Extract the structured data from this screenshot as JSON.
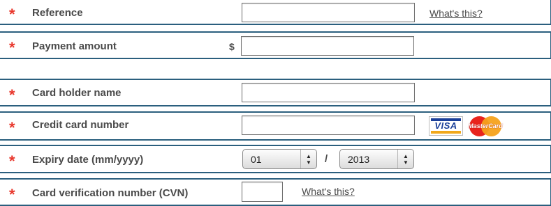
{
  "form": {
    "reference": {
      "label": "Reference",
      "required_mark": "*",
      "value": "",
      "help_link": "What's this?"
    },
    "payment_amount": {
      "label": "Payment amount",
      "required_mark": "*",
      "currency_symbol": "$",
      "value": ""
    },
    "card_holder_name": {
      "label": "Card holder name",
      "required_mark": "*",
      "value": ""
    },
    "credit_card_number": {
      "label": "Credit card number",
      "required_mark": "*",
      "value": "",
      "card_logos": [
        {
          "icon": "visa-logo",
          "text": "VISA"
        },
        {
          "icon": "mastercard-logo",
          "text": "MasterCard"
        }
      ]
    },
    "expiry_date": {
      "label": "Expiry date (mm/yyyy)",
      "required_mark": "*",
      "month": "01",
      "separator": "/",
      "year": "2013"
    },
    "cvn": {
      "label": "Card verification number (CVN)",
      "required_mark": "*",
      "value": "",
      "help_link": "What's this?"
    }
  },
  "colors": {
    "required_star": "#e8362b",
    "row_border": "#2b5f7e",
    "label_text": "#4a4a4a"
  }
}
